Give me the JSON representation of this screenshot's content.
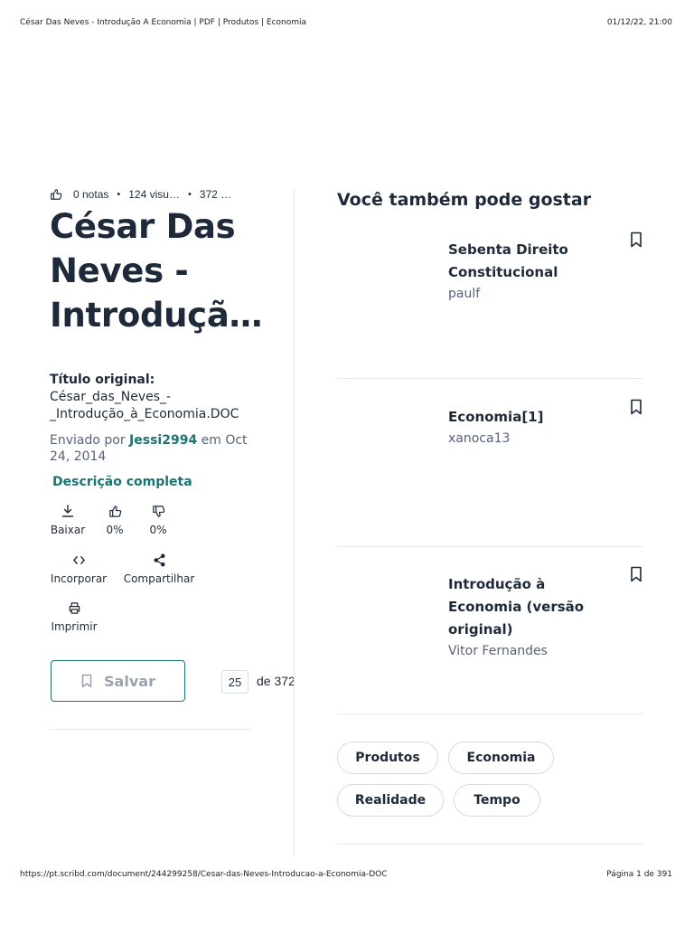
{
  "print_header": {
    "title": "César Das Neves - Introdução A Economia | PDF | Produtos | Economia",
    "datetime": "01/12/22, 21:00"
  },
  "print_footer": {
    "url": "https://pt.scribd.com/document/244299258/Cesar-das-Neves-Introducao-a-Economia-DOC",
    "page": "Página 1 de 391"
  },
  "document": {
    "stats": {
      "ratings": "0 notas",
      "views": "124 visu…",
      "pages": "372 …"
    },
    "title": "César Das Neves - Introduçã…",
    "original_title_label": "Título original:",
    "original_title_value": "César_das_Neves_-_Introdução_à_Economia.DOC",
    "sent_prefix": "Enviado por",
    "uploader": "Jessi2994",
    "sent_suffix": "em Oct 24, 2014",
    "description_link": "Descrição completa"
  },
  "actions": {
    "download": "Baixar",
    "like_pct": "0%",
    "dislike_pct": "0%",
    "embed": "Incorporar",
    "share": "Compartilhar",
    "print": "Imprimir"
  },
  "save_button": "Salvar",
  "pagination": {
    "current": "25",
    "of": "de 372"
  },
  "recommendations": {
    "heading": "Você também pode gostar",
    "items": [
      {
        "title": "Sebenta Direito Constitucional",
        "author": "paulf"
      },
      {
        "title": "Economia[1]",
        "author": "xanoca13"
      },
      {
        "title": "Introdução à Economia (versão original)",
        "author": "Vitor Fernandes"
      }
    ]
  },
  "tags": [
    "Produtos",
    "Economia",
    "Realidade",
    "Tempo"
  ],
  "colors": {
    "accent": "#1a7471",
    "text": "#1e2a3a",
    "muted": "#57617a",
    "border": "#d7dbe2"
  }
}
